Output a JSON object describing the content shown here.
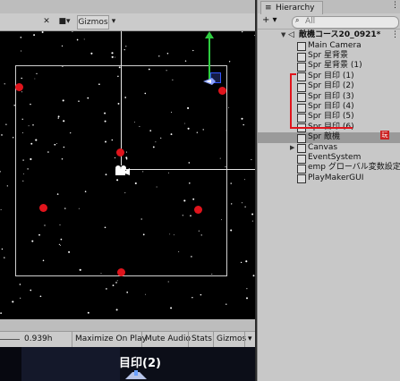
{
  "scene": {
    "toolbar": {
      "gizmos_label": "Gizmos",
      "dropdown_arrow": "▾"
    }
  },
  "game": {
    "scale_value": "0.939h",
    "maximize_label": "Maximize On Play",
    "mute_label": "Mute Audio",
    "stats_label": "Stats",
    "gizmos_label": "Gizmos",
    "overlay_label": "目印(2)"
  },
  "hierarchy": {
    "tab_title": "Hierarchy",
    "add_label": "+ ▾",
    "search_placeholder": "All",
    "scene_name": "敵機コース20_0921*",
    "items": [
      {
        "label": "Main Camera"
      },
      {
        "label": "Spr 星背景"
      },
      {
        "label": "Spr 星背景 (1)"
      },
      {
        "label": "Spr 目印 (1)"
      },
      {
        "label": "Spr 目印 (2)"
      },
      {
        "label": "Spr 目印 (3)"
      },
      {
        "label": "Spr 目印 (4)"
      },
      {
        "label": "Spr 目印 (5)"
      },
      {
        "label": "Spr 目印 (6)"
      },
      {
        "label": "Spr 敵機"
      },
      {
        "label": "Canvas"
      },
      {
        "label": "EventSystem"
      },
      {
        "label": "emp グローバル変数設定"
      },
      {
        "label": "PlayMakerGUI"
      }
    ],
    "badge_label": "玩"
  },
  "colors": {
    "marker": "#e0141c",
    "gizmo_green": "#2ecc40",
    "selection": "#9a9a9a"
  }
}
